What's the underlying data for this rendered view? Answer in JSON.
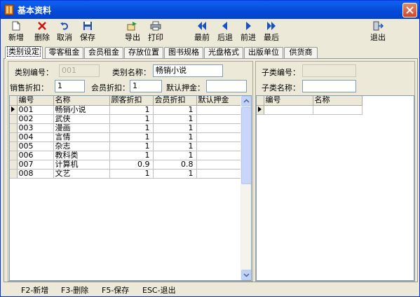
{
  "window": {
    "title": "基本资料"
  },
  "toolbar": {
    "new": "新增",
    "delete": "删除",
    "cancel": "取消",
    "save": "保存",
    "export": "导出",
    "print": "打印",
    "first": "最前",
    "prev": "后退",
    "next": "前进",
    "last": "最后",
    "exit": "退出"
  },
  "tabs": [
    "类别设定",
    "零客租金",
    "会员租金",
    "存放位置",
    "图书规格",
    "光盘格式",
    "出版单位",
    "供货商"
  ],
  "form": {
    "category_code_label": "类别编号：",
    "category_code_value": "001",
    "category_name_label": "类别名称：",
    "category_name_value": "畅销小说",
    "sale_discount_label": "销售折扣：",
    "sale_discount_value": "1",
    "member_discount_label": "会员折扣：",
    "member_discount_value": "1",
    "default_deposit_label": "默认押金：",
    "default_deposit_value": ""
  },
  "left_grid": {
    "headers": [
      "编号",
      "名称",
      "顾客折扣",
      "会员折扣",
      "默认押金"
    ],
    "rows": [
      [
        "001",
        "畅销小说",
        "1",
        "1",
        ""
      ],
      [
        "002",
        "武侠",
        "1",
        "1",
        ""
      ],
      [
        "003",
        "漫画",
        "1",
        "1",
        ""
      ],
      [
        "004",
        "言情",
        "1",
        "1",
        ""
      ],
      [
        "005",
        "杂志",
        "1",
        "1",
        ""
      ],
      [
        "006",
        "教科类",
        "1",
        "1",
        ""
      ],
      [
        "007",
        "计算机",
        "0.9",
        "0.8",
        ""
      ],
      [
        "008",
        "文艺",
        "1",
        "1",
        ""
      ]
    ]
  },
  "right_form": {
    "sub_code_label": "子类编号：",
    "sub_code_value": "",
    "sub_name_label": "子类名称：",
    "sub_name_value": ""
  },
  "right_grid": {
    "headers": [
      "编号",
      "名称"
    ]
  },
  "statusbar": {
    "f2": "F2-新增",
    "f3": "F3-删除",
    "f5": "F5-保存",
    "esc": "ESC-退出"
  }
}
